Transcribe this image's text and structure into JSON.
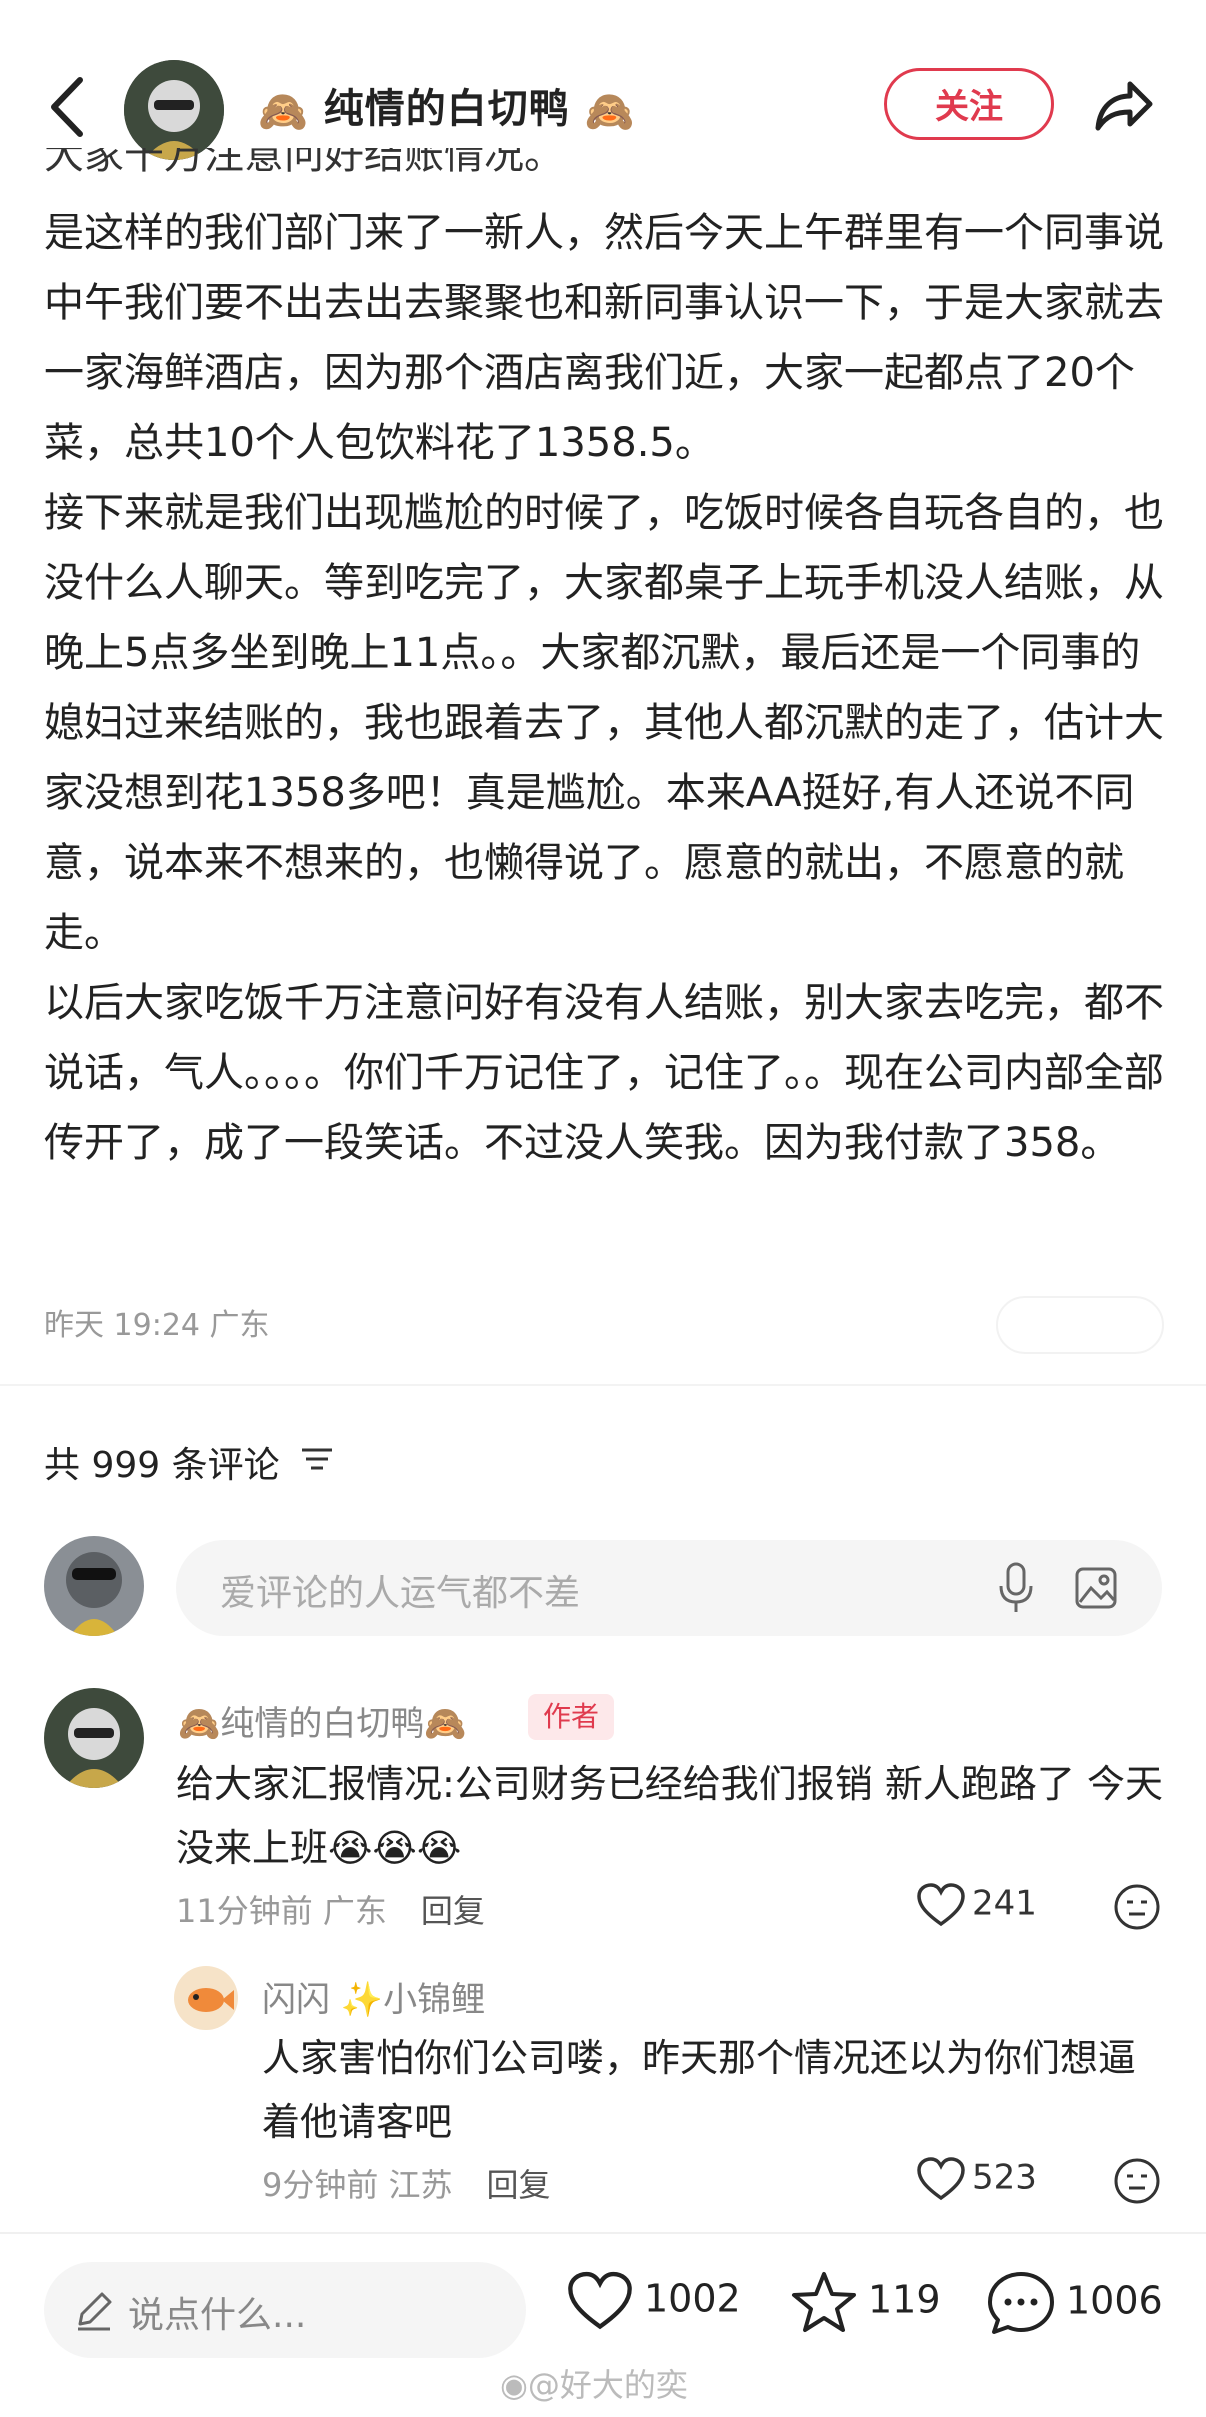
{
  "header": {
    "author_name": "纯情的白切鸭",
    "follow_label": "关注"
  },
  "post": {
    "cut_line": "大家千万注意问好结账情况。",
    "paragraphs": [
      "是这样的我们部门来了一新人，然后今天上午群里有一个同事说中午我们要不出去出去聚聚也和新同事认识一下，于是大家就去一家海鲜酒店，因为那个酒店离我们近，大家一起都点了20个菜，总共10个人包饮料花了1358.5。",
      "接下来就是我们出现尴尬的时候了，吃饭时候各自玩各自的，也没什么人聊天。等到吃完了，大家都桌子上玩手机没人结账，从晚上5点多坐到晚上11点。。大家都沉默，最后还是一个同事的媳妇过来结账的，我也跟着去了，其他人都沉默的走了，估计大家没想到花1358多吧！真是尴尬。本来AA挺好,有人还说不同意，说本来不想来的，也懒得说了。愿意的就出，不愿意的就走。",
      "以后大家吃饭千万注意问好有没有人结账，别大家去吃完，都不说话，气人。。。。你们千万记住了，记住了。。现在公司内部全部传开了，成了一段笑话。不过没人笑我。因为我付款了358。"
    ],
    "meta": "昨天 19:24 广东"
  },
  "comments": {
    "count_label": "共 999 条评论",
    "input_placeholder": "爱评论的人运气都不差",
    "items": [
      {
        "name": "纯情的白切鸭",
        "tag": "作者",
        "text": "给大家汇报情况:公司财务已经给我们报销 新人跑路了 今天没来上班",
        "emoji": "😭😭😭",
        "time_loc": "11分钟前 广东",
        "reply": "回复",
        "likes": "241"
      },
      {
        "name": "闪闪 ✨小锦鲤",
        "text": "人家害怕你们公司喽，昨天那个情况还以为你们想逼着他请客吧",
        "time_loc": "9分钟前 江苏",
        "reply": "回复",
        "likes": "523"
      }
    ]
  },
  "bottom_bar": {
    "say_placeholder": "说点什么...",
    "likes": "1002",
    "stars": "119",
    "comments": "1006"
  },
  "watermark": "@好大的奕",
  "colors": {
    "accent": "#e03a4e",
    "muted": "#999999"
  },
  "icons": [
    "back-icon",
    "share-icon",
    "filter-icon",
    "mic-icon",
    "image-icon",
    "heart-icon",
    "face-icon",
    "pen-icon",
    "star-icon",
    "chat-icon",
    "weibo-icon"
  ]
}
